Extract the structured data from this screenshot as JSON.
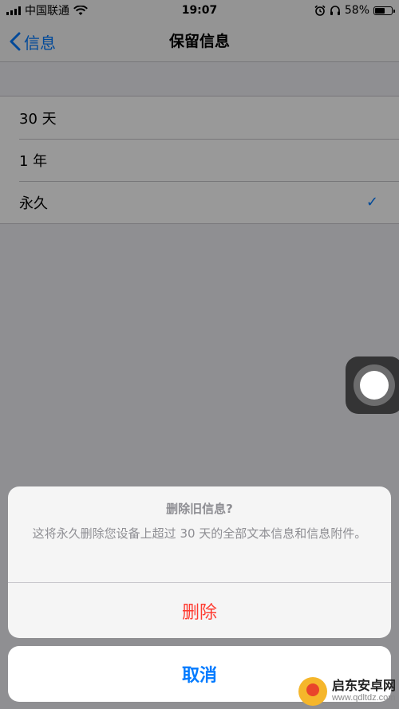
{
  "status_bar": {
    "carrier": "中国联通",
    "time": "19:07",
    "battery_percent": "58%",
    "battery_level": 0.58,
    "icons": [
      "signal-icon",
      "wifi-icon",
      "alarm-icon",
      "headphones-icon",
      "battery-icon"
    ]
  },
  "nav": {
    "back_label": "信息",
    "title": "保留信息"
  },
  "options": [
    {
      "label": "30 天",
      "selected": false
    },
    {
      "label": "1 年",
      "selected": false
    },
    {
      "label": "永久",
      "selected": true
    }
  ],
  "check_icon": "✓",
  "action_sheet": {
    "title": "删除旧信息?",
    "message": "这将永久删除您设备上超过 30 天的全部文本信息和信息附件。",
    "delete_label": "删除",
    "cancel_label": "取消"
  },
  "watermark": {
    "name": "启东安卓网",
    "url": "www.qdltdz.com"
  },
  "colors": {
    "accent": "#007aff",
    "destructive": "#ff3b30"
  }
}
